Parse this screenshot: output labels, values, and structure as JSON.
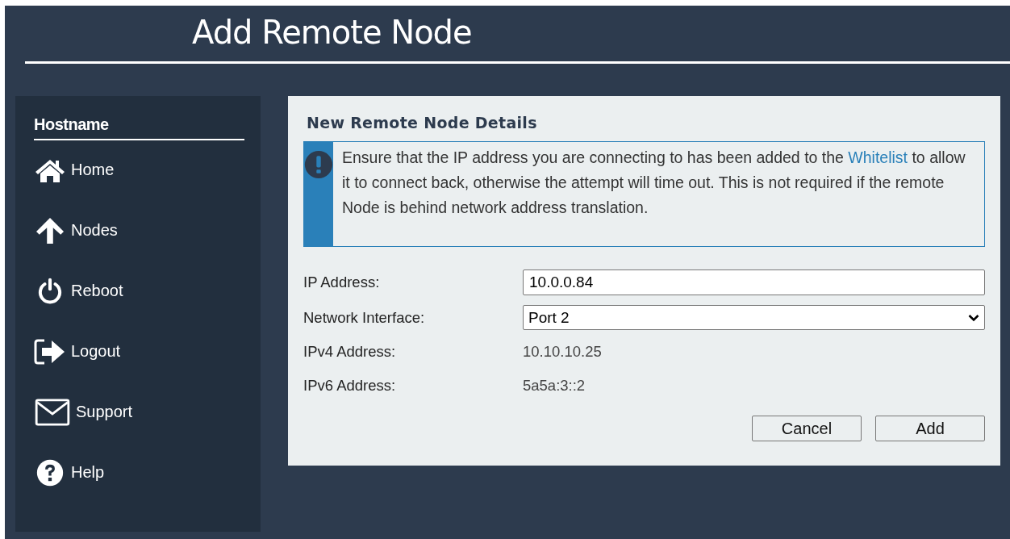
{
  "page": {
    "title": "Add Remote Node"
  },
  "sidebar": {
    "heading": "Hostname",
    "items": [
      {
        "label": "Home"
      },
      {
        "label": "Nodes"
      },
      {
        "label": "Reboot"
      },
      {
        "label": "Logout"
      },
      {
        "label": "Support"
      },
      {
        "label": "Help"
      }
    ]
  },
  "panel": {
    "title": "New Remote Node Details",
    "alert": {
      "text_before": "Ensure that the IP address you are connecting to has been added to the ",
      "link": "Whitelist",
      "text_after": " to allow it to connect back, otherwise the attempt will time out. This is not required if the remote Node is behind network address translation."
    },
    "ip_address": {
      "label": "IP Address:",
      "value": "10.0.0.84"
    },
    "network_interface": {
      "label": "Network Interface:",
      "value": "Port 2"
    },
    "ipv4": {
      "label": "IPv4 Address:",
      "value": "10.10.10.25"
    },
    "ipv6": {
      "label": "IPv6 Address:",
      "value": "5a5a:3::2"
    },
    "buttons": [
      "Cancel",
      "Add"
    ]
  }
}
